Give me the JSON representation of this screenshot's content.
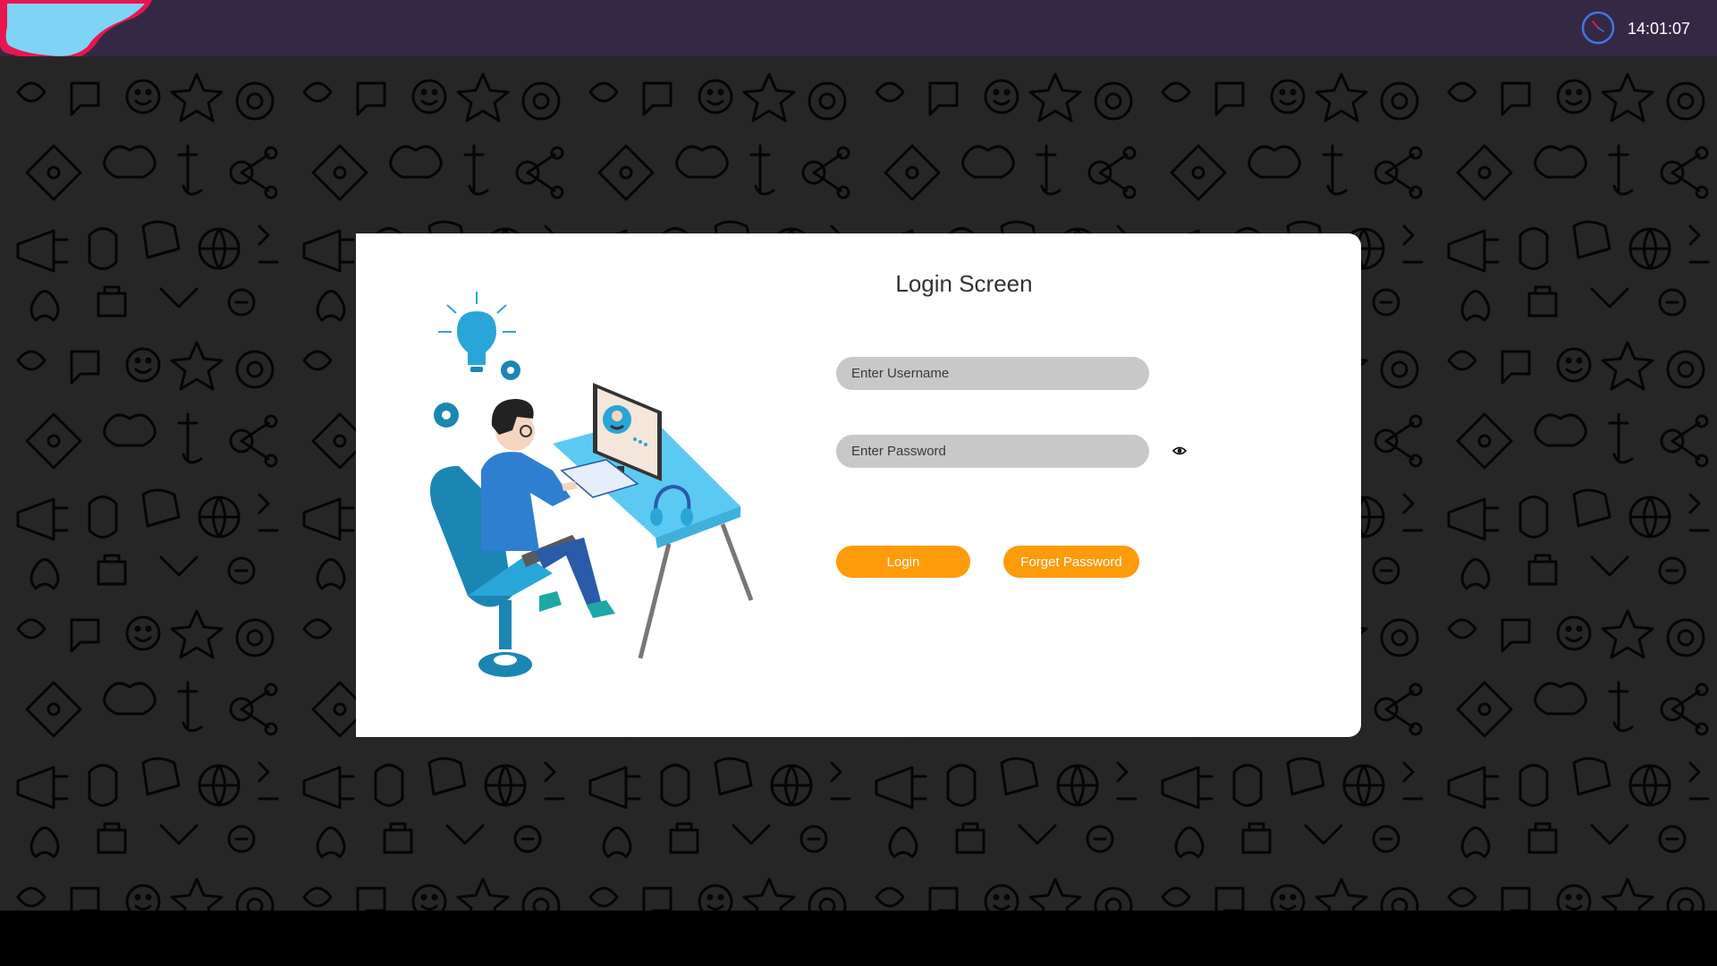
{
  "topbar": {
    "clock_icon": "clock-icon",
    "time": "14:01:07",
    "colors": {
      "background": "#352845",
      "logo_fill": "#7fd3f5",
      "logo_edge": "#e8154f"
    }
  },
  "background": {
    "pattern": "doodle-icons",
    "color": "#262626"
  },
  "login": {
    "title": "Login Screen",
    "username": {
      "placeholder": "Enter Username",
      "value": ""
    },
    "password": {
      "placeholder": "Enter Password",
      "value": ""
    },
    "show_password_icon": "eye-icon",
    "login_label": "Login",
    "forgot_label": "Forget Password",
    "colors": {
      "button": "#fe9b0b",
      "field": "#c8c8c8",
      "accent": "#2aa5d8"
    }
  }
}
